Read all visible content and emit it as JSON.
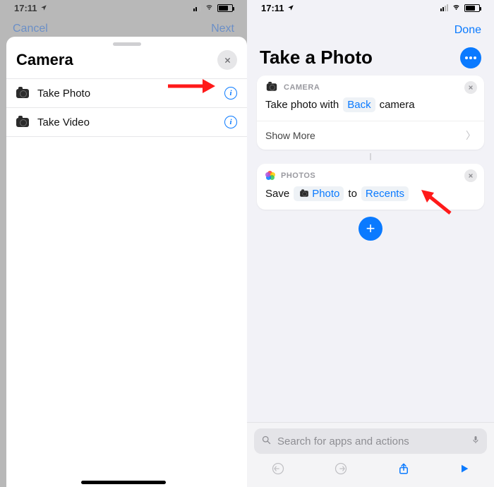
{
  "status": {
    "time": "17:11"
  },
  "left": {
    "cancel": "Cancel",
    "next": "Next",
    "sheet_title": "Camera",
    "rows": [
      {
        "label": "Take Photo"
      },
      {
        "label": "Take Video"
      }
    ]
  },
  "right": {
    "done": "Done",
    "title": "Take a Photo",
    "card1": {
      "app": "CAMERA",
      "text_prefix": "Take photo with",
      "token": "Back",
      "text_suffix": "camera",
      "show_more": "Show More"
    },
    "card2": {
      "app": "PHOTOS",
      "text_prefix": "Save",
      "token1": "Photo",
      "mid": "to",
      "token2": "Recents"
    },
    "search_placeholder": "Search for apps and actions"
  }
}
